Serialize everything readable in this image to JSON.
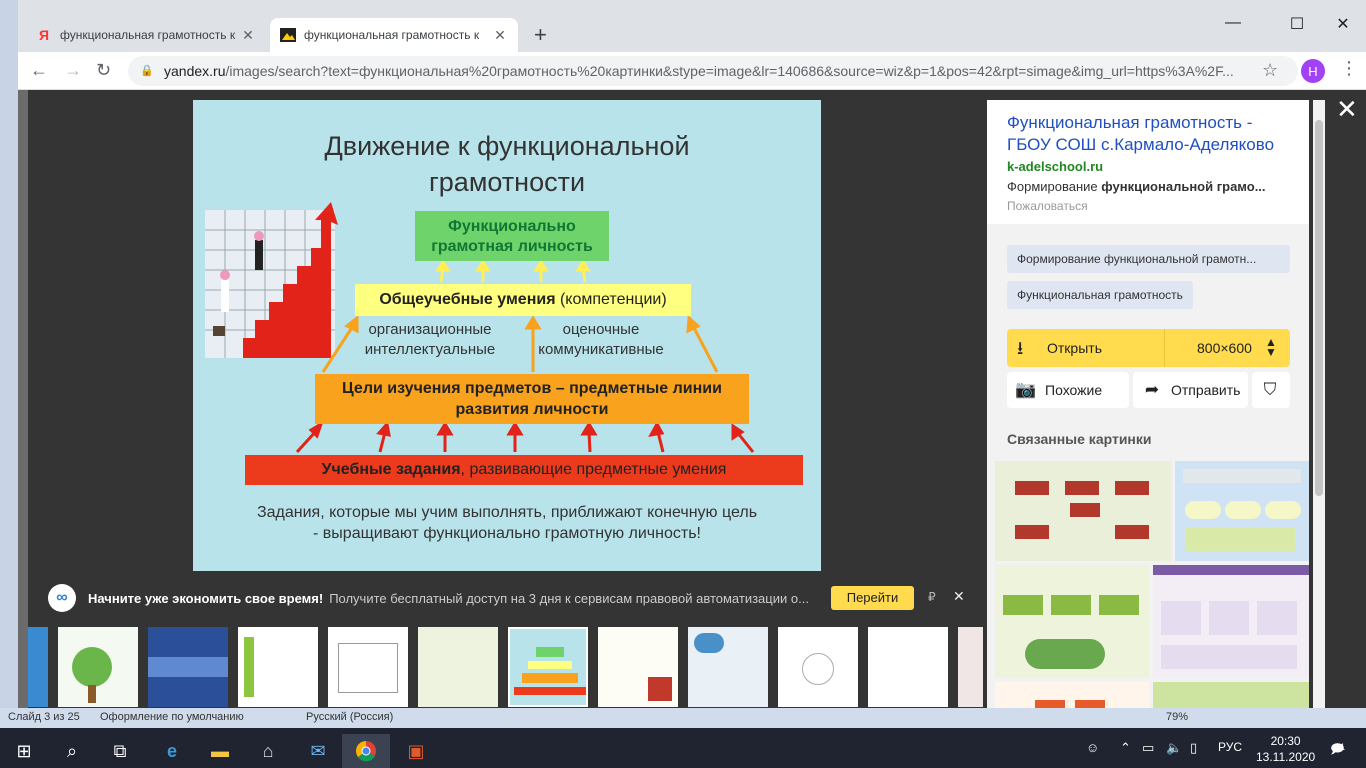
{
  "browser": {
    "tabs": [
      {
        "label": "функциональная грамотность к",
        "favicon": "Я"
      },
      {
        "label": "функциональная грамотность к",
        "favicon": "image"
      }
    ],
    "url_host": "yandex.ru",
    "url_path": "/images/search?text=функциональная%20грамотность%20картинки&stype=image&lr=140686&source=wiz&p=1&pos=42&rpt=simage&img_url=https%3A%2F...",
    "profile_initial": "Н"
  },
  "slide": {
    "title_line1": "Движение к функциональной",
    "title_line2": "грамотности",
    "green_line1": "Функционально",
    "green_line2": "грамотная личность",
    "yellow_bold": "Общеучебные умения",
    "yellow_rest": " (компетенции)",
    "left_line1": "организационные",
    "left_line2": "интеллектуальные",
    "right_line1": "оценочные",
    "right_line2": "коммуникативные",
    "orange_line1": "Цели изучения предметов – предметные линии",
    "orange_line2": "развития личности",
    "red_bold": "Учебные задания",
    "red_rest": ", развивающие предметные умения",
    "caption_line1": "Задания, которые мы учим выполнять, приближают конечную цель",
    "caption_line2": "- выращивают функционально грамотную личность!"
  },
  "panel": {
    "title": "Функциональная грамотность - ГБОУ СОШ с.Кармало-Аделяково",
    "domain": "k-adelschool.ru",
    "snippet_prefix": "Формирование ",
    "snippet_bold": "функциональной грамо...",
    "complain": "Пожаловаться",
    "tags": [
      "Формирование функциональной грамотн...",
      "Функциональная грамотность"
    ],
    "open_label": "Открыть",
    "size_label": "800×600",
    "similar_label": "Похожие",
    "share_label": "Отправить",
    "related_title": "Связанные картинки"
  },
  "promo": {
    "bold": "Начните уже экономить свое время!",
    "text": "Получите бесплатный доступ на 3 дня к сервисам правовой автоматизации о...",
    "button": "Перейти",
    "ad_mark": "₽"
  },
  "ppt_status": {
    "slide": "Слайд 3 из 25",
    "theme": "Оформление по умолчанию",
    "lang": "Русский (Россия)",
    "zoom": "79%"
  },
  "taskbar": {
    "lang": "РУС",
    "time": "20:30",
    "date": "13.11.2020",
    "notifications": "1"
  }
}
